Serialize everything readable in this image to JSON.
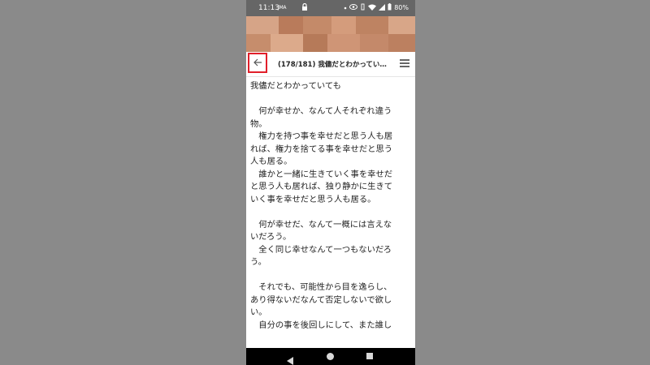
{
  "status_bar": {
    "time": "11:13",
    "small_label": "JMA",
    "battery": "80%"
  },
  "app_bar": {
    "title": "(178/181) 我儘だとわかってい…"
  },
  "content_lines": [
    "我儘だとわかっていても",
    "",
    "　何が幸せか、なんて人それぞれ違う",
    "物。",
    "　権力を持つ事を幸せだと思う人も居",
    "れば、権力を捨てる事を幸せだと思う",
    "人も居る。",
    "　誰かと一緒に生きていく事を幸せだ",
    "と思う人も居れば、独り静かに生きて",
    "いく事を幸せだと思う人も居る。",
    "",
    "　何が幸せだ、なんて一概には言えな",
    "いだろう。",
    "　全く同じ幸せなんて一つもないだろ",
    "う。",
    "",
    "　それでも、可能性から目を逸らし、",
    "あり得ないだなんて否定しないで欲し",
    "い。",
    "　自分の事を後回しにして、また誰し"
  ],
  "colors": {
    "highlight_box": "#e11f2a",
    "status_bar": "#666666",
    "nav_bar": "#000000"
  }
}
